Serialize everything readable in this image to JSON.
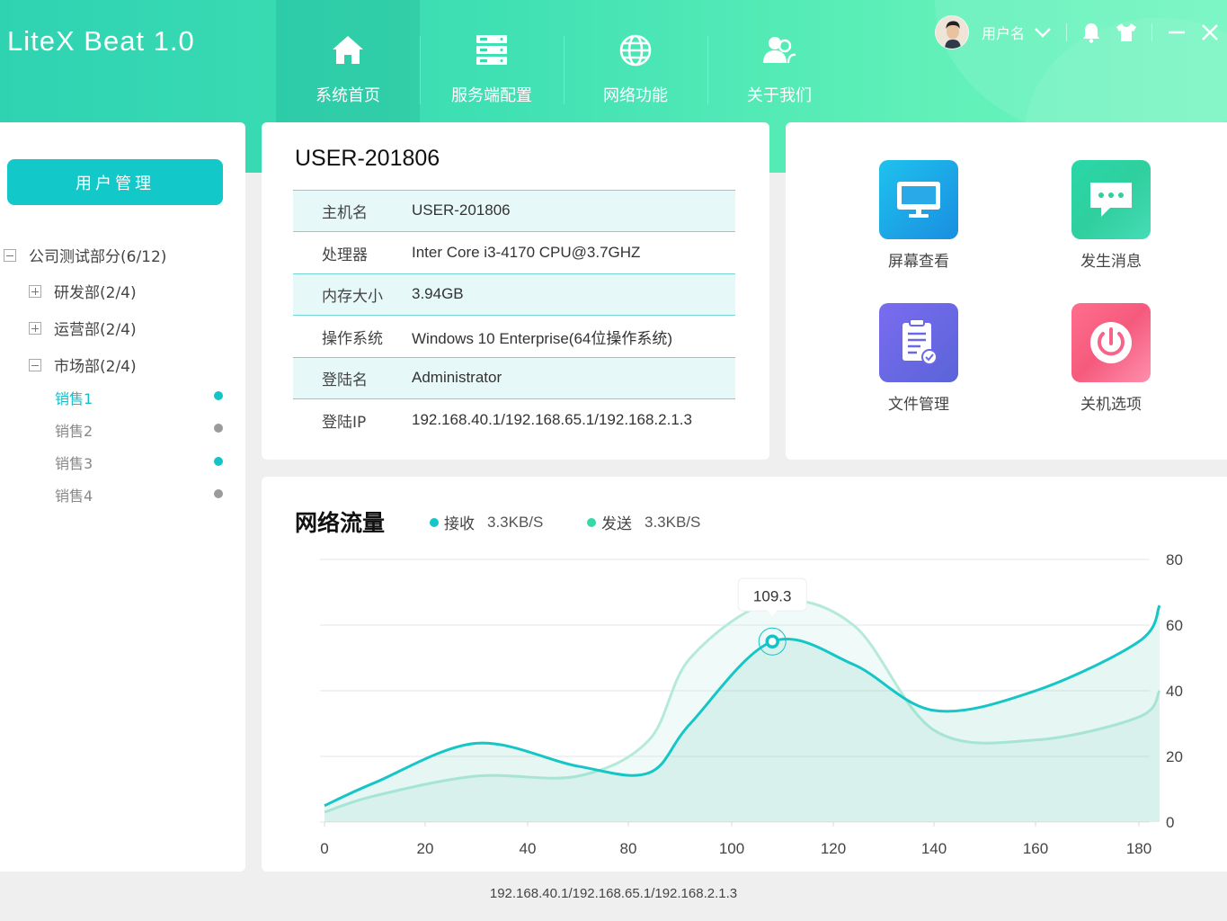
{
  "app": {
    "title": "LiteX Beat  1.0"
  },
  "nav": [
    {
      "label": "系统首页",
      "icon": "home-icon",
      "active": true
    },
    {
      "label": "服务端配置",
      "icon": "server-icon",
      "active": false
    },
    {
      "label": "网络功能",
      "icon": "globe-icon",
      "active": false
    },
    {
      "label": "关于我们",
      "icon": "users-icon",
      "active": false
    }
  ],
  "user": {
    "name": "用户名"
  },
  "sidebar": {
    "button_label": "用户管理",
    "tree": {
      "root": "公司测试部分(6/12)",
      "groups": [
        "研发部(2/4)",
        "运营部(2/4)",
        "市场部(2/4)"
      ],
      "leaves": [
        {
          "label": "销售1",
          "status": "online"
        },
        {
          "label": "销售2",
          "status": "offline"
        },
        {
          "label": "销售3",
          "status": "online"
        },
        {
          "label": "销售4",
          "status": "offline"
        }
      ]
    }
  },
  "computer": {
    "title": "USER-201806",
    "rows": [
      {
        "key": "主机名",
        "value": "USER-201806"
      },
      {
        "key": "处理器",
        "value": "Inter Core i3-4170 CPU@3.7GHZ"
      },
      {
        "key": "内存大小",
        "value": "3.94GB"
      },
      {
        "key": "操作系统",
        "value": "Windows 10 Enterprise(64位操作系统)"
      },
      {
        "key": "登陆名",
        "value": "Administrator"
      },
      {
        "key": "登陆IP",
        "value": "192.168.40.1/192.168.65.1/192.168.2.1.3"
      }
    ]
  },
  "actions": [
    {
      "label": "屏幕查看",
      "icon": "monitor-icon"
    },
    {
      "label": "发生消息",
      "icon": "message-icon"
    },
    {
      "label": "文件管理",
      "icon": "file-icon"
    },
    {
      "label": "关机选项",
      "icon": "power-icon"
    }
  ],
  "network": {
    "title": "网络流量",
    "legend": [
      {
        "name": "接收",
        "value": "3.3KB/S",
        "color": "#16c6c6"
      },
      {
        "name": "发送",
        "value": "3.3KB/S",
        "color": "#37d8a8"
      }
    ]
  },
  "chart_data": {
    "type": "area",
    "title": "网络流量",
    "x_tick_labels": [
      "0",
      "20",
      "40",
      "80",
      "100",
      "120",
      "140",
      "160",
      "180"
    ],
    "y_ticks": [
      0,
      20,
      40,
      60,
      80
    ],
    "ylim": [
      0,
      80
    ],
    "axis_position": "right",
    "grid": true,
    "tooltip": {
      "label": "109.3",
      "x_index": 4.4,
      "y": 55
    },
    "series": [
      {
        "name": "接收",
        "color": "#16c6c6",
        "x_index": [
          0,
          0.5,
          1.5,
          2.5,
          3.2,
          3.6,
          4.4,
          5.2,
          6.0,
          7.0,
          8.0,
          8.2
        ],
        "values": [
          5,
          12,
          24,
          17,
          15,
          30,
          55,
          48,
          34,
          40,
          55,
          66
        ]
      },
      {
        "name": "发送",
        "color": "#37d8a8",
        "x_index": [
          0,
          0.5,
          1.5,
          2.5,
          3.2,
          3.6,
          4.4,
          5.2,
          6.0,
          7.0,
          8.0,
          8.2
        ],
        "values": [
          3,
          8,
          14,
          14,
          25,
          50,
          67,
          60,
          28,
          25,
          32,
          40
        ]
      }
    ]
  },
  "footer": {
    "ip": "192.168.40.1/192.168.65.1/192.168.2.1.3"
  }
}
